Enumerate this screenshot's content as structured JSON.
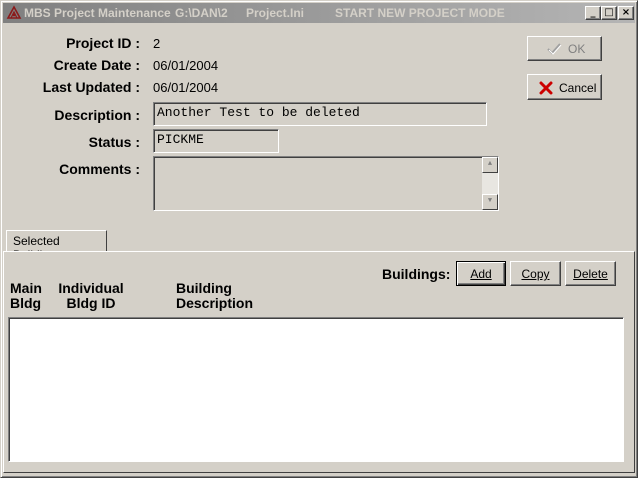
{
  "titlebar": {
    "app_name": "MBS Project Maintenance",
    "path": "G:\\DAN\\2",
    "ini_file": "Project.Ini",
    "mode": "START NEW PROJECT MODE",
    "minimize_glyph": "_",
    "maximize_glyph": "□",
    "close_glyph": "×"
  },
  "form": {
    "project_id_label": "Project ID :",
    "project_id_value": "2",
    "create_date_label": "Create Date :",
    "create_date_value": "06/01/2004",
    "last_updated_label": "Last Updated :",
    "last_updated_value": "06/01/2004",
    "description_label": "Description :",
    "description_value": "Another Test to be deleted",
    "status_label": "Status :",
    "status_value": "PICKME",
    "comments_label": "Comments :",
    "comments_value": ""
  },
  "actions": {
    "ok_label": "OK",
    "ok_enabled": false,
    "cancel_label": "Cancel"
  },
  "tab": {
    "label": "Selected Buildings"
  },
  "buildings": {
    "label": "Buildings:",
    "add_label": "Add",
    "copy_label": "Copy",
    "delete_label": "Delete",
    "columns": [
      {
        "line1": "Main",
        "line2": "Bldg"
      },
      {
        "line1": "Individual",
        "line2": "Bldg ID"
      },
      {
        "line1": "Building",
        "line2": "Description"
      }
    ],
    "rows": []
  },
  "colors": {
    "face": "#d4d0c8",
    "titlebar_inactive_start": "#808080",
    "titlebar_inactive_end": "#b5b5b5",
    "cancel_x": "#cc0000",
    "ok_check": "#a0a0a0"
  },
  "icons": {
    "app": "app-logo-icon",
    "ok": "checkmark-icon",
    "cancel": "red-x-icon"
  }
}
